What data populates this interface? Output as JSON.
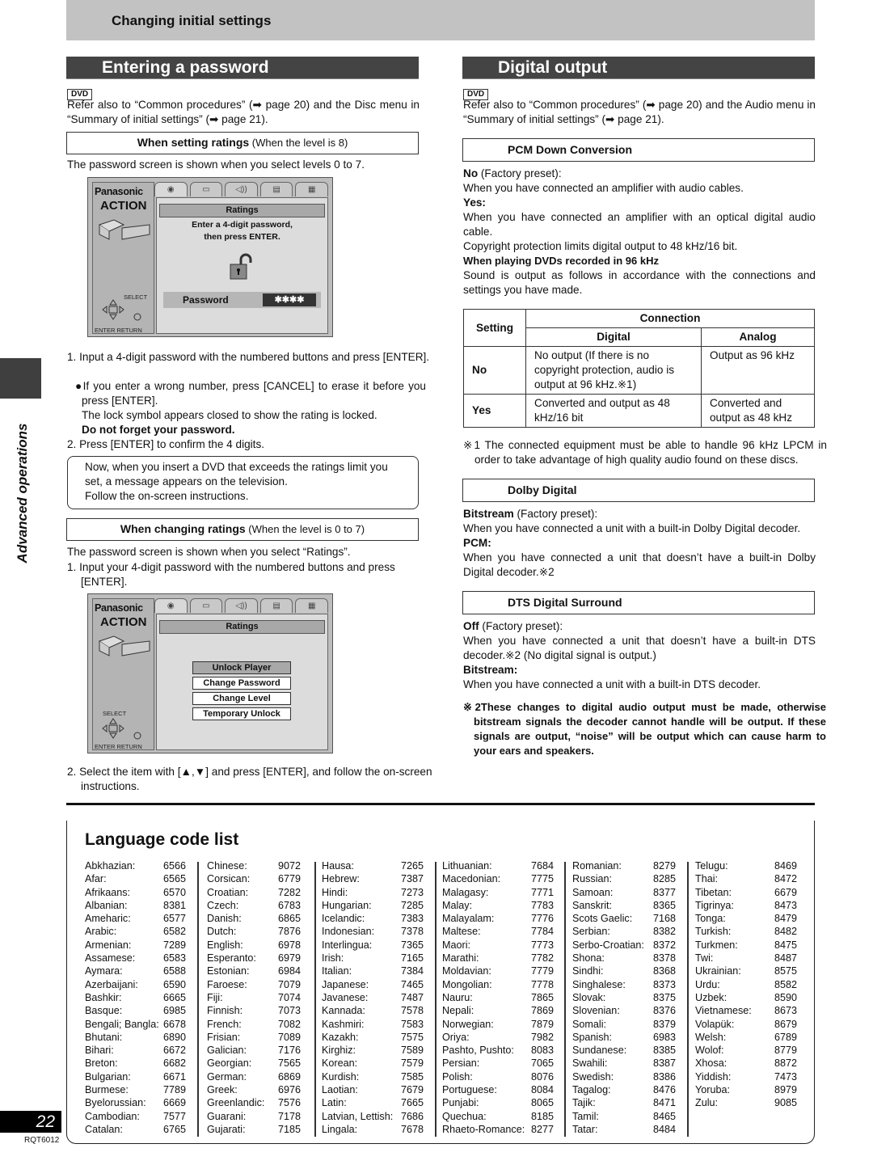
{
  "header": {
    "title": "Changing initial settings"
  },
  "side_label": "Advanced operations",
  "page_number": "22",
  "doc_id": "RQT6012",
  "left": {
    "title": "Entering a password",
    "badge": "DVD",
    "intro": "Refer also to “Common procedures” (➡ page 20) and the Disc menu in “Summary of initial settings” (➡ page 21).",
    "setting_box": {
      "bold": "When setting ratings",
      "normal": " (When the level is 8)"
    },
    "setting_desc": "The password screen is shown when you select levels 0 to 7.",
    "osd1": {
      "brand": "Panasonic",
      "action": "ACTION",
      "tabs": [
        "disc-icon",
        "picture-icon",
        "audio-icon",
        "display-icon",
        "other-icon"
      ],
      "title": "Ratings",
      "line1": "Enter a 4-digit password,",
      "line2": "then press ENTER.",
      "password_label": "Password",
      "password_value": "✱✱✱✱",
      "select": "SELECT",
      "enter": "ENTER",
      "return": "RETURN"
    },
    "step1": "1. Input a 4-digit password with the numbered buttons and press [ENTER].",
    "bullet": "●If you enter a wrong number, press [CANCEL] to erase it before you press [ENTER].",
    "lock_note": "The lock symbol appears closed to show the rating is locked.",
    "warning": "Do not forget your password.",
    "step2": "2. Press [ENTER] to confirm the 4 digits.",
    "note_box": [
      "Now, when you insert a DVD that exceeds the ratings limit you",
      "set, a message appears on the television.",
      "Follow the on-screen instructions."
    ],
    "changing_box": {
      "bold": "When changing ratings",
      "normal": " (When the level is 0 to 7)"
    },
    "changing_desc": "The password screen is shown when you select “Ratings”.",
    "changing_step1": "1. Input your 4-digit password with the numbered buttons and press [ENTER].",
    "osd2": {
      "brand": "Panasonic",
      "action": "ACTION",
      "title": "Ratings",
      "menu": [
        "Unlock Player",
        "Change Password",
        "Change Level",
        "Temporary Unlock"
      ],
      "select": "SELECT",
      "enter": "ENTER",
      "return": "RETURN"
    },
    "changing_step2": "2. Select the item with [▲,▼] and press [ENTER], and follow the on-screen instructions."
  },
  "right": {
    "title": "Digital output",
    "badge": "DVD",
    "intro": "Refer also to “Common procedures” (➡ page 20) and the Audio menu in “Summary of initial settings” (➡ page 21).",
    "pcm": {
      "heading": "PCM Down Conversion",
      "no_label": "No",
      "no_suffix": " (Factory preset):",
      "no_desc": "When you have connected an amplifier with audio cables.",
      "yes_label": "Yes:",
      "yes_desc": "When you have connected an amplifier with an optical digital audio cable.",
      "copyright": "Copyright protection limits digital output to 48 kHz/16 bit.",
      "dvd96_label": "When playing DVDs recorded in 96 kHz",
      "dvd96_desc": "Sound is output as follows in accordance with the connections and settings you have made."
    },
    "table": {
      "h_setting": "Setting",
      "h_connection": "Connection",
      "h_digital": "Digital",
      "h_analog": "Analog",
      "rows": [
        {
          "setting": "No",
          "digital": "No output (If there is no copyright protection, audio is output at 96 kHz.※1)",
          "analog": "Output as 96 kHz"
        },
        {
          "setting": "Yes",
          "digital": "Converted and output as 48 kHz/16 bit",
          "analog": "Converted and output as 48 kHz"
        }
      ]
    },
    "footnote1": "※1 The connected equipment must be able to handle 96 kHz LPCM in order to take advantage of high quality audio found on these discs.",
    "dolby": {
      "heading": "Dolby Digital",
      "bit_label": "Bitstream",
      "bit_suffix": " (Factory preset):",
      "bit_desc": "When you have connected a unit with a built-in Dolby Digital decoder.",
      "pcm_label": "PCM:",
      "pcm_desc": "When you have connected a unit that doesn’t have a built-in Dolby Digital decoder.※2"
    },
    "dts": {
      "heading": "DTS Digital Surround",
      "off_label": "Off",
      "off_suffix": " (Factory preset):",
      "off_desc": "When you have connected a unit that doesn’t have a built-in DTS decoder.※2 (No digital signal is output.)",
      "bit_label": "Bitstream:",
      "bit_desc": "When you have connected a unit with a built-in DTS decoder."
    },
    "footnote2": "※2These changes to digital audio output must be made, otherwise bitstream signals the decoder cannot handle will be output. If these signals are output, “noise” will be output which can cause harm to your ears and speakers."
  },
  "language_list": {
    "title": "Language code list",
    "columns": [
      [
        [
          "Abkhazian:",
          "6566"
        ],
        [
          "Afar:",
          "6565"
        ],
        [
          "Afrikaans:",
          "6570"
        ],
        [
          "Albanian:",
          "8381"
        ],
        [
          "Ameharic:",
          "6577"
        ],
        [
          "Arabic:",
          "6582"
        ],
        [
          "Armenian:",
          "7289"
        ],
        [
          "Assamese:",
          "6583"
        ],
        [
          "Aymara:",
          "6588"
        ],
        [
          "Azerbaijani:",
          "6590"
        ],
        [
          "Bashkir:",
          "6665"
        ],
        [
          "Basque:",
          "6985"
        ],
        [
          "Bengali; Bangla:",
          "6678"
        ],
        [
          "Bhutani:",
          "6890"
        ],
        [
          "Bihari:",
          "6672"
        ],
        [
          "Breton:",
          "6682"
        ],
        [
          "Bulgarian:",
          "6671"
        ],
        [
          "Burmese:",
          "7789"
        ],
        [
          "Byelorussian:",
          "6669"
        ],
        [
          "Cambodian:",
          "7577"
        ],
        [
          "Catalan:",
          "6765"
        ]
      ],
      [
        [
          "Chinese:",
          "9072"
        ],
        [
          "Corsican:",
          "6779"
        ],
        [
          "Croatian:",
          "7282"
        ],
        [
          "Czech:",
          "6783"
        ],
        [
          "Danish:",
          "6865"
        ],
        [
          "Dutch:",
          "7876"
        ],
        [
          "English:",
          "6978"
        ],
        [
          "Esperanto:",
          "6979"
        ],
        [
          "Estonian:",
          "6984"
        ],
        [
          "Faroese:",
          "7079"
        ],
        [
          "Fiji:",
          "7074"
        ],
        [
          "Finnish:",
          "7073"
        ],
        [
          "French:",
          "7082"
        ],
        [
          "Frisian:",
          "7089"
        ],
        [
          "Galician:",
          "7176"
        ],
        [
          "Georgian:",
          "7565"
        ],
        [
          "German:",
          "6869"
        ],
        [
          "Greek:",
          "6976"
        ],
        [
          "Greenlandic:",
          "7576"
        ],
        [
          "Guarani:",
          "7178"
        ],
        [
          "Gujarati:",
          "7185"
        ]
      ],
      [
        [
          "Hausa:",
          "7265"
        ],
        [
          "Hebrew:",
          "7387"
        ],
        [
          "Hindi:",
          "7273"
        ],
        [
          "Hungarian:",
          "7285"
        ],
        [
          "Icelandic:",
          "7383"
        ],
        [
          "Indonesian:",
          "7378"
        ],
        [
          "Interlingua:",
          "7365"
        ],
        [
          "Irish:",
          "7165"
        ],
        [
          "Italian:",
          "7384"
        ],
        [
          "Japanese:",
          "7465"
        ],
        [
          "Javanese:",
          "7487"
        ],
        [
          "Kannada:",
          "7578"
        ],
        [
          "Kashmiri:",
          "7583"
        ],
        [
          "Kazakh:",
          "7575"
        ],
        [
          "Kirghiz:",
          "7589"
        ],
        [
          "Korean:",
          "7579"
        ],
        [
          "Kurdish:",
          "7585"
        ],
        [
          "Laotian:",
          "7679"
        ],
        [
          "Latin:",
          "7665"
        ],
        [
          "Latvian, Lettish:",
          "7686"
        ],
        [
          "Lingala:",
          "7678"
        ]
      ],
      [
        [
          "Lithuanian:",
          "7684"
        ],
        [
          "Macedonian:",
          "7775"
        ],
        [
          "Malagasy:",
          "7771"
        ],
        [
          "Malay:",
          "7783"
        ],
        [
          "Malayalam:",
          "7776"
        ],
        [
          "Maltese:",
          "7784"
        ],
        [
          "Maori:",
          "7773"
        ],
        [
          "Marathi:",
          "7782"
        ],
        [
          "Moldavian:",
          "7779"
        ],
        [
          "Mongolian:",
          "7778"
        ],
        [
          "Nauru:",
          "7865"
        ],
        [
          "Nepali:",
          "7869"
        ],
        [
          "Norwegian:",
          "7879"
        ],
        [
          "Oriya:",
          "7982"
        ],
        [
          "Pashto, Pushto:",
          "8083"
        ],
        [
          "Persian:",
          "7065"
        ],
        [
          "Polish:",
          "8076"
        ],
        [
          "Portuguese:",
          "8084"
        ],
        [
          "Punjabi:",
          "8065"
        ],
        [
          "Quechua:",
          "8185"
        ],
        [
          "Rhaeto-Romance:",
          "8277"
        ]
      ],
      [
        [
          "Romanian:",
          "8279"
        ],
        [
          "Russian:",
          "8285"
        ],
        [
          "Samoan:",
          "8377"
        ],
        [
          "Sanskrit:",
          "8365"
        ],
        [
          "Scots Gaelic:",
          "7168"
        ],
        [
          "Serbian:",
          "8382"
        ],
        [
          "Serbo-Croatian:",
          "8372"
        ],
        [
          "Shona:",
          "8378"
        ],
        [
          "Sindhi:",
          "8368"
        ],
        [
          "Singhalese:",
          "8373"
        ],
        [
          "Slovak:",
          "8375"
        ],
        [
          "Slovenian:",
          "8376"
        ],
        [
          "Somali:",
          "8379"
        ],
        [
          "Spanish:",
          "6983"
        ],
        [
          "Sundanese:",
          "8385"
        ],
        [
          "Swahili:",
          "8387"
        ],
        [
          "Swedish:",
          "8386"
        ],
        [
          "Tagalog:",
          "8476"
        ],
        [
          "Tajik:",
          "8471"
        ],
        [
          "Tamil:",
          "8465"
        ],
        [
          "Tatar:",
          "8484"
        ]
      ],
      [
        [
          "Telugu:",
          "8469"
        ],
        [
          "Thai:",
          "8472"
        ],
        [
          "Tibetan:",
          "6679"
        ],
        [
          "Tigrinya:",
          "8473"
        ],
        [
          "Tonga:",
          "8479"
        ],
        [
          "Turkish:",
          "8482"
        ],
        [
          "Turkmen:",
          "8475"
        ],
        [
          "Twi:",
          "8487"
        ],
        [
          "Ukrainian:",
          "8575"
        ],
        [
          "Urdu:",
          "8582"
        ],
        [
          "Uzbek:",
          "8590"
        ],
        [
          "Vietnamese:",
          "8673"
        ],
        [
          "Volapük:",
          "8679"
        ],
        [
          "Welsh:",
          "6789"
        ],
        [
          "Wolof:",
          "8779"
        ],
        [
          "Xhosa:",
          "8872"
        ],
        [
          "Yiddish:",
          "7473"
        ],
        [
          "Yoruba:",
          "8979"
        ],
        [
          "Zulu:",
          "9085"
        ]
      ]
    ]
  }
}
